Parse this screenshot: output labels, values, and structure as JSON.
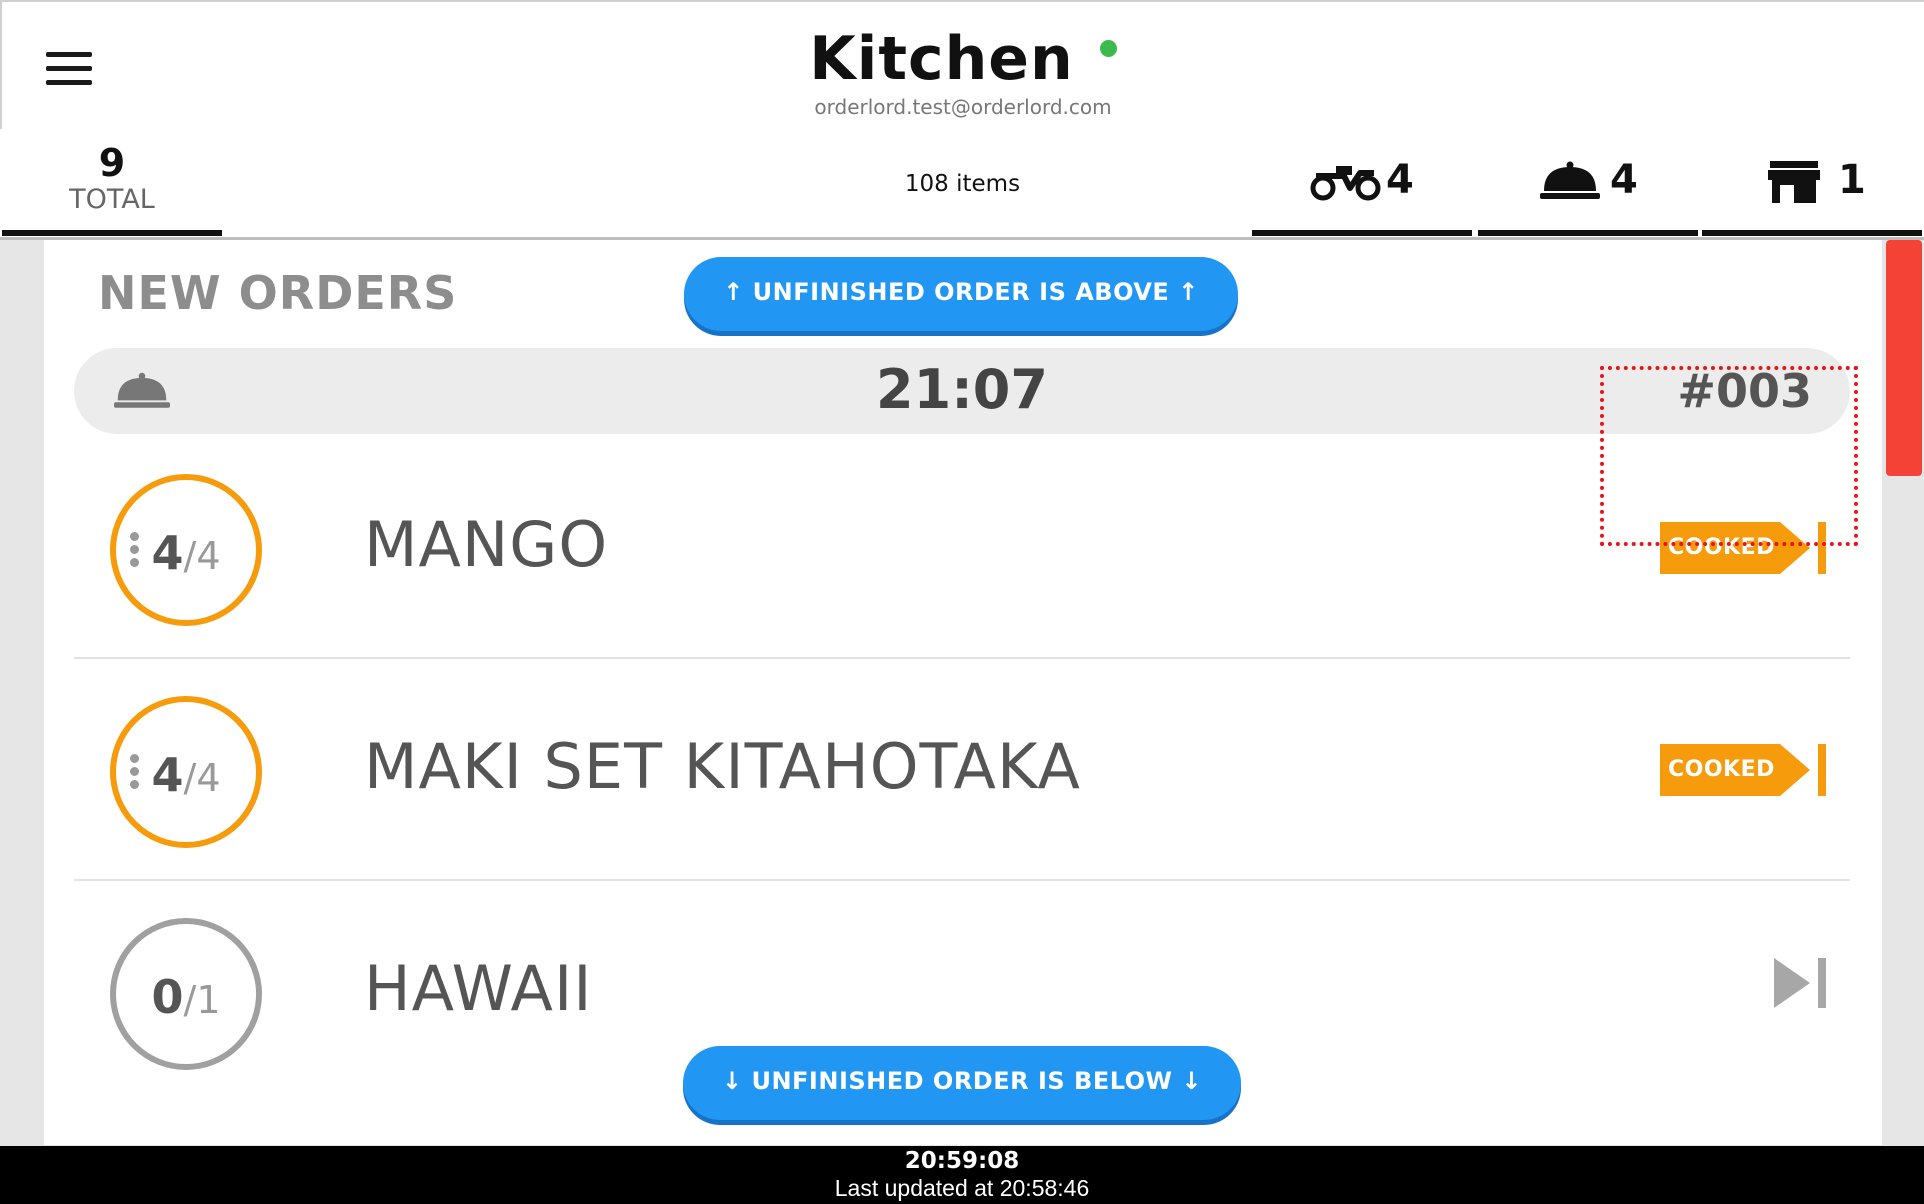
{
  "header": {
    "title": "Kitchen",
    "user_email": "orderlord.test@orderlord.com",
    "status_color": "#3dba4e"
  },
  "stats": {
    "total_count": "9",
    "total_label": "TOTAL",
    "items_label": "108 items",
    "delivery_count": "4",
    "dine_in_count": "4",
    "takeaway_count": "1"
  },
  "section": {
    "title": "NEW ORDERS",
    "scroll_up_label": "↑  UNFINISHED ORDER IS ABOVE  ↑",
    "scroll_down_label": "↓  UNFINISHED ORDER IS BELOW  ↓"
  },
  "order": {
    "time": "21:07",
    "number": "#003",
    "type_icon": "dish-cloche-icon",
    "items": [
      {
        "name": "MANGO",
        "done": "4",
        "total": "/4",
        "action": "COOKED"
      },
      {
        "name": "MAKI SET KITAHOTAKA",
        "done": "4",
        "total": "/4",
        "action": "COOKED"
      },
      {
        "name": "HAWAII",
        "done": "0",
        "total": "/1",
        "action": "skip-forward-icon"
      }
    ]
  },
  "footer": {
    "clock": "20:59:08",
    "last_updated": "Last updated at 20:58:46"
  },
  "colors": {
    "accent_blue": "#2196f3",
    "cooked_orange": "#f59b0c",
    "scroll_red": "#f44336"
  }
}
